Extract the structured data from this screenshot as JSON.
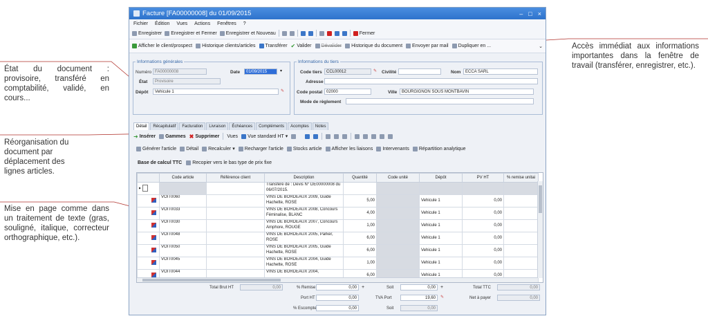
{
  "annotations": {
    "left1": "État du document : provisoire, transféré en comptabilité, validé, en cours...",
    "left2": "Réorganisation du document par déplacement des lignes articles.",
    "left3": "Mise en page comme dans un traitement de texte (gras, souligné, italique, correcteur orthographique, etc.).",
    "right1": "Accès immédiat aux informations importantes dans la fenêtre de travail (transférer, enregistrer, etc.)."
  },
  "window": {
    "title": "Facture [FA00000008] du 01/09/2015",
    "controls": [
      "–",
      "□",
      "×"
    ]
  },
  "menu": [
    "Fichier",
    "Édition",
    "Vues",
    "Actions",
    "Fenêtres",
    "?"
  ],
  "toolbar1": {
    "save": "Enregistrer",
    "save_close": "Enregistrer et Fermer",
    "save_new": "Enregistrer et Nouveau",
    "close": "Fermer"
  },
  "toolbar2": {
    "show_client": "Afficher le client/prospect",
    "history_client": "Historique clients/articles",
    "transfer": "Transférer",
    "validate": "Valider",
    "devalidate": "Dévalider",
    "history_doc": "Historique du document",
    "send_mail": "Envoyer par mail",
    "duplicate": "Dupliquer en ..."
  },
  "general": {
    "legend": "Informations générales",
    "numero_label": "Numéro",
    "numero_value": "FA00000008",
    "date_label": "Date",
    "date_value": "01/09/2015",
    "etat_label": "État",
    "etat_value": "Provisoire",
    "depot_label": "Dépôt",
    "depot_value": "Vehicule 1"
  },
  "tiers": {
    "legend": "Informations du tiers",
    "code_label": "Code tiers",
    "code_value": "CCL00012",
    "civilite_label": "Civilité",
    "nom_label": "Nom",
    "nom_value": "ECCA SARL",
    "adresse_label": "Adresse",
    "cp_label": "Code postal",
    "cp_value": "02000",
    "ville_label": "Ville",
    "ville_value": "BOURGIGNON SOUS MONTBAVIN",
    "mode_label": "Mode de règlement"
  },
  "tabs": [
    "Détail",
    "Récapitulatif",
    "Facturation",
    "Livraison",
    "Échéances",
    "Compléments",
    "Acomptes",
    "Notes"
  ],
  "gridbar1": {
    "insert": "Insérer",
    "gammes": "Gammes",
    "delete": "Supprimer",
    "vues": "Vues",
    "vue_std": "Vue standard HT"
  },
  "gridbar2": {
    "generate": "Générer l'article",
    "detail": "Détail",
    "recalc": "Recalculer",
    "reload": "Recharger l'article",
    "stock": "Stocks article",
    "links": "Afficher les liaisons",
    "intervenants": "Intervenants",
    "analytique": "Répartition analytique"
  },
  "basecalc": {
    "label": "Base de calcul TTC",
    "copy": "Recopier vers le bas type de prix fixe"
  },
  "grid": {
    "columns": [
      "Code article",
      "Référence client",
      "Description",
      "Quantité",
      "Code unité",
      "Dépôt",
      "PV HT",
      "% remise unitai"
    ],
    "rows": [
      {
        "code": "",
        "desc": "Transféré de : Devis N° DE00000008 du 06/07/2015.",
        "qty": "",
        "depot": "",
        "pv": ""
      },
      {
        "code": "VOIT0060",
        "desc": "VINS DE BORDEAUX 2009, Guide Hachette, ROSE",
        "qty": "5,00",
        "depot": "Vehicule 1",
        "pv": "0,00"
      },
      {
        "code": "VOIT0033",
        "desc": "VINS DE BORDEAUX 2008, Concours Féminalise, BLANC",
        "qty": "4,00",
        "depot": "Vehicule 1",
        "pv": "0,00"
      },
      {
        "code": "VOIT0030",
        "desc": "VINS DE BORDEAUX 2007, Concours Amphore, ROUGE",
        "qty": "1,00",
        "depot": "Vehicule 1",
        "pv": "0,00"
      },
      {
        "code": "VOIT0048",
        "desc": "VINS DE BORDEAUX 2005, Parker, ROSE",
        "qty": "6,00",
        "depot": "Vehicule 1",
        "pv": "0,00"
      },
      {
        "code": "VOIT0050",
        "desc": "VINS DE BORDEAUX 2005, Guide Hachette, ROSE",
        "qty": "6,00",
        "depot": "Vehicule 1",
        "pv": "0,00"
      },
      {
        "code": "VOIT0045",
        "desc": "VINS DE BORDEAUX 2004, Guide Hachette, ROSE",
        "qty": "1,00",
        "depot": "Vehicule 1",
        "pv": "0,00"
      },
      {
        "code": "VOIT0044",
        "desc": "VINS DE BORDEAUX 2004,",
        "qty": "6,00",
        "depot": "Vehicule 1",
        "pv": "0,00"
      }
    ]
  },
  "totals": {
    "brut_label": "Total Brut HT",
    "brut_value": "0,00",
    "remise_label": "% Remise",
    "remise_value": "0,00",
    "soit1_label": "Soit",
    "soit1_value": "0,00",
    "ttc_label": "Total TTC",
    "ttc_value": "0,00",
    "port_label": "Port HT",
    "port_value": "0,00",
    "tva_label": "TVA Port",
    "tva_value": "19,60",
    "net_label": "Net à payer",
    "net_value": "0,00",
    "escompte_label": "% Escompte",
    "escompte_value": "0,00",
    "soit2_label": "Soit",
    "soit2_value": "0,00"
  },
  "colors": {
    "title_bar": "#2e73cc",
    "annotation_line": "#b0312b",
    "selection": "#2f6ed8"
  }
}
